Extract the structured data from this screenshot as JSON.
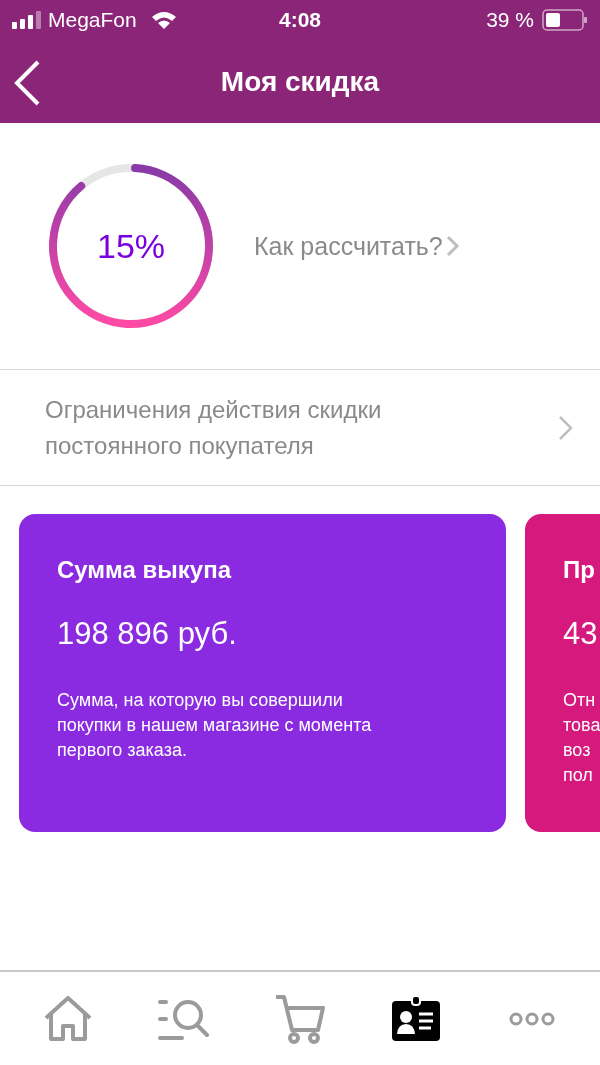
{
  "status_bar": {
    "carrier": "MegaFon",
    "time": "4:08",
    "battery": "39 %"
  },
  "header": {
    "title": "Моя скидка"
  },
  "discount": {
    "value": "15%",
    "level": 0.88,
    "link": "Как рассчитать?"
  },
  "restrictions": {
    "label": "Ограничения действия скидки постоянного покупателя"
  },
  "cards": [
    {
      "title": "Сумма выкупа",
      "value": "198 896 руб.",
      "description": [
        "Сумма, на которую вы совершили покупки в нашем магазине с момента первого заказа."
      ],
      "color": "#8a2be2"
    },
    {
      "title": "Пр",
      "value": "43",
      "description": [
        "Отн",
        "това",
        "воз",
        "пол"
      ],
      "color": "#d6197d"
    }
  ],
  "tab_bar": [
    {
      "kind": "home",
      "selected": false
    },
    {
      "kind": "search",
      "selected": false
    },
    {
      "kind": "cart",
      "selected": false
    },
    {
      "kind": "profile",
      "selected": true
    },
    {
      "kind": "more",
      "selected": false
    }
  ]
}
